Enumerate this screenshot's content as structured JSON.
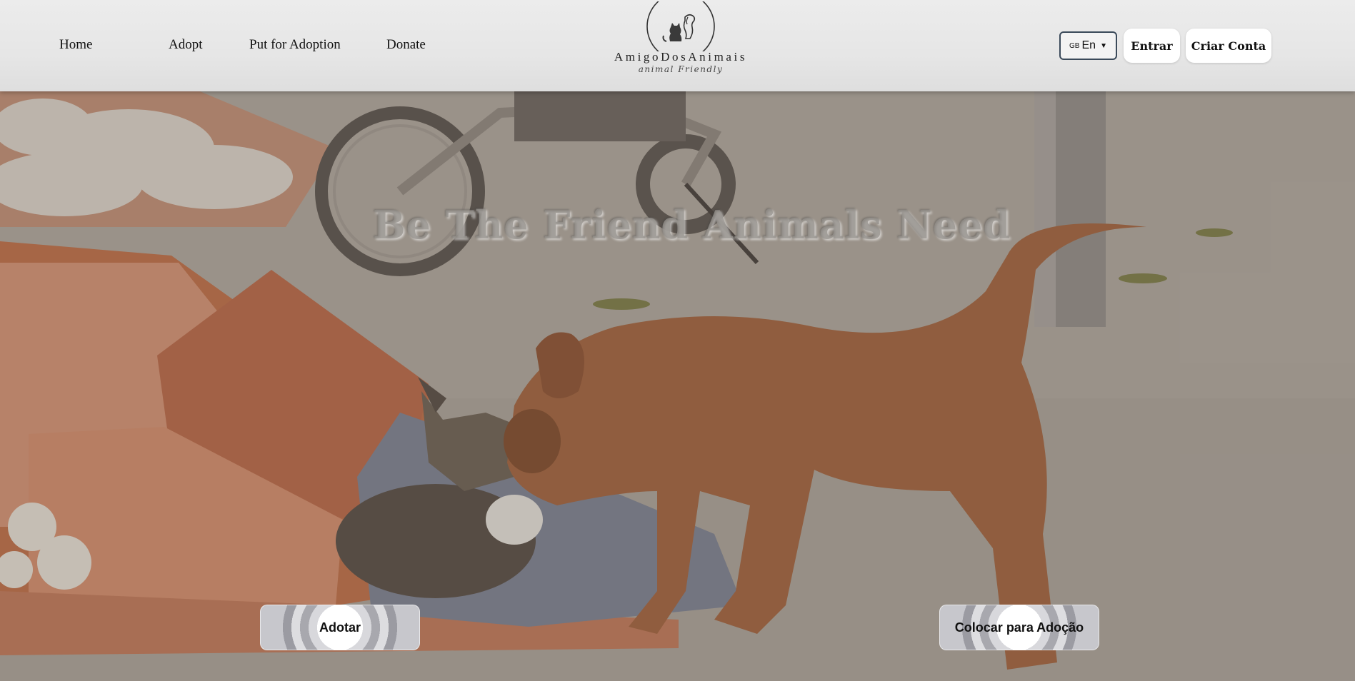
{
  "nav": {
    "links": [
      {
        "label": "Home"
      },
      {
        "label": "Adopt"
      },
      {
        "label": "Put for Adoption"
      },
      {
        "label": "Donate"
      }
    ]
  },
  "logo": {
    "name": "AmigoDosAnimais",
    "tagline": "animal Friendly"
  },
  "language": {
    "flag": "GB",
    "selected": "En"
  },
  "auth": {
    "login_label": "Entrar",
    "signup_label": "Criar Conta"
  },
  "hero": {
    "title": "Be The Friend Animals Need",
    "adopt_label": "Adotar",
    "put_for_adoption_label": "Colocar para Adoção"
  },
  "icons": {
    "logo": "dog-and-cat-icon",
    "caret": "chevron-down-icon"
  }
}
